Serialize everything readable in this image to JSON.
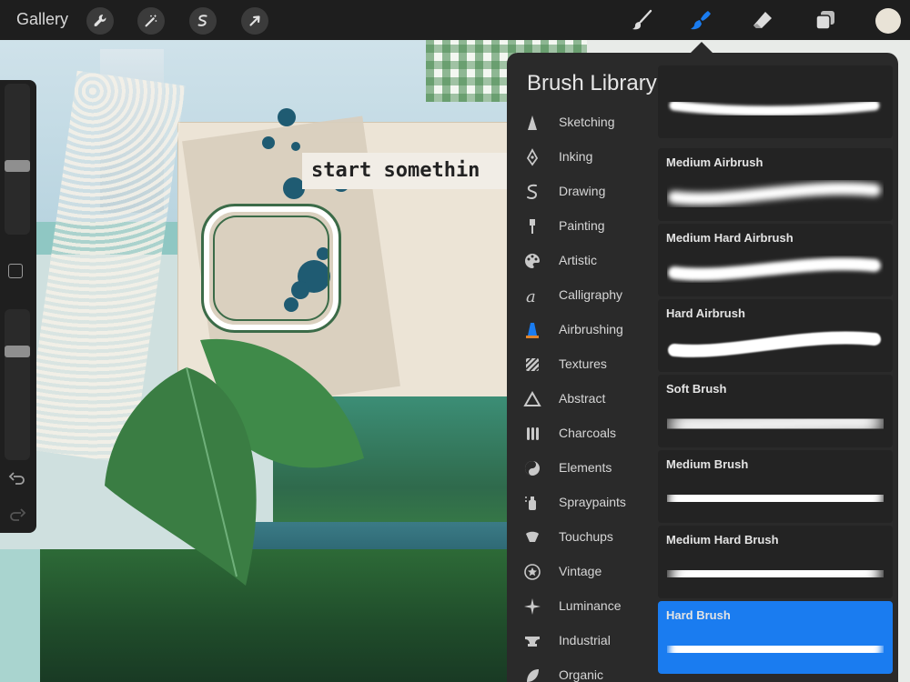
{
  "topbar": {
    "gallery_label": "Gallery",
    "left_tools": [
      "wrench-icon",
      "magic-wand-icon",
      "selection-icon",
      "transform-arrow-icon"
    ],
    "right_tools": [
      "brush-icon",
      "smudge-icon",
      "eraser-icon",
      "layers-icon"
    ],
    "active_tool": "smudge-icon",
    "accent_color": "#1a7cf0",
    "current_color": "#e9e3d7"
  },
  "canvas": {
    "stamp_text": "start somethin"
  },
  "panel": {
    "title": "Brush Library",
    "categories": [
      {
        "label": "Sketching",
        "icon": "pencil-tip-icon"
      },
      {
        "label": "Inking",
        "icon": "pen-nib-icon"
      },
      {
        "label": "Drawing",
        "icon": "squiggle-icon"
      },
      {
        "label": "Painting",
        "icon": "paintbrush-icon"
      },
      {
        "label": "Artistic",
        "icon": "palette-icon"
      },
      {
        "label": "Calligraphy",
        "icon": "calligraphy-a-icon"
      },
      {
        "label": "Airbrushing",
        "icon": "airbrush-icon"
      },
      {
        "label": "Textures",
        "icon": "texture-icon"
      },
      {
        "label": "Abstract",
        "icon": "triangle-icon"
      },
      {
        "label": "Charcoals",
        "icon": "charcoal-icon"
      },
      {
        "label": "Elements",
        "icon": "yin-yang-icon"
      },
      {
        "label": "Spraypaints",
        "icon": "spray-can-icon"
      },
      {
        "label": "Touchups",
        "icon": "touchup-icon"
      },
      {
        "label": "Vintage",
        "icon": "star-badge-icon"
      },
      {
        "label": "Luminance",
        "icon": "sparkle-icon"
      },
      {
        "label": "Industrial",
        "icon": "anvil-icon"
      },
      {
        "label": "Organic",
        "icon": "leaf-icon"
      }
    ],
    "selected_category": "Airbrushing",
    "brushes": [
      {
        "name": "",
        "style": "partial"
      },
      {
        "name": "Medium Airbrush",
        "style": "soft-thin"
      },
      {
        "name": "Medium Hard Airbrush",
        "style": "medium-thin"
      },
      {
        "name": "Hard Airbrush",
        "style": "hard-thin"
      },
      {
        "name": "Soft Brush",
        "style": "very-soft-thick"
      },
      {
        "name": "Medium Brush",
        "style": "soft-thick"
      },
      {
        "name": "Medium Hard Brush",
        "style": "medium-thick"
      },
      {
        "name": "Hard Brush",
        "style": "hard-thick"
      }
    ],
    "selected_brush": "Hard Brush"
  }
}
